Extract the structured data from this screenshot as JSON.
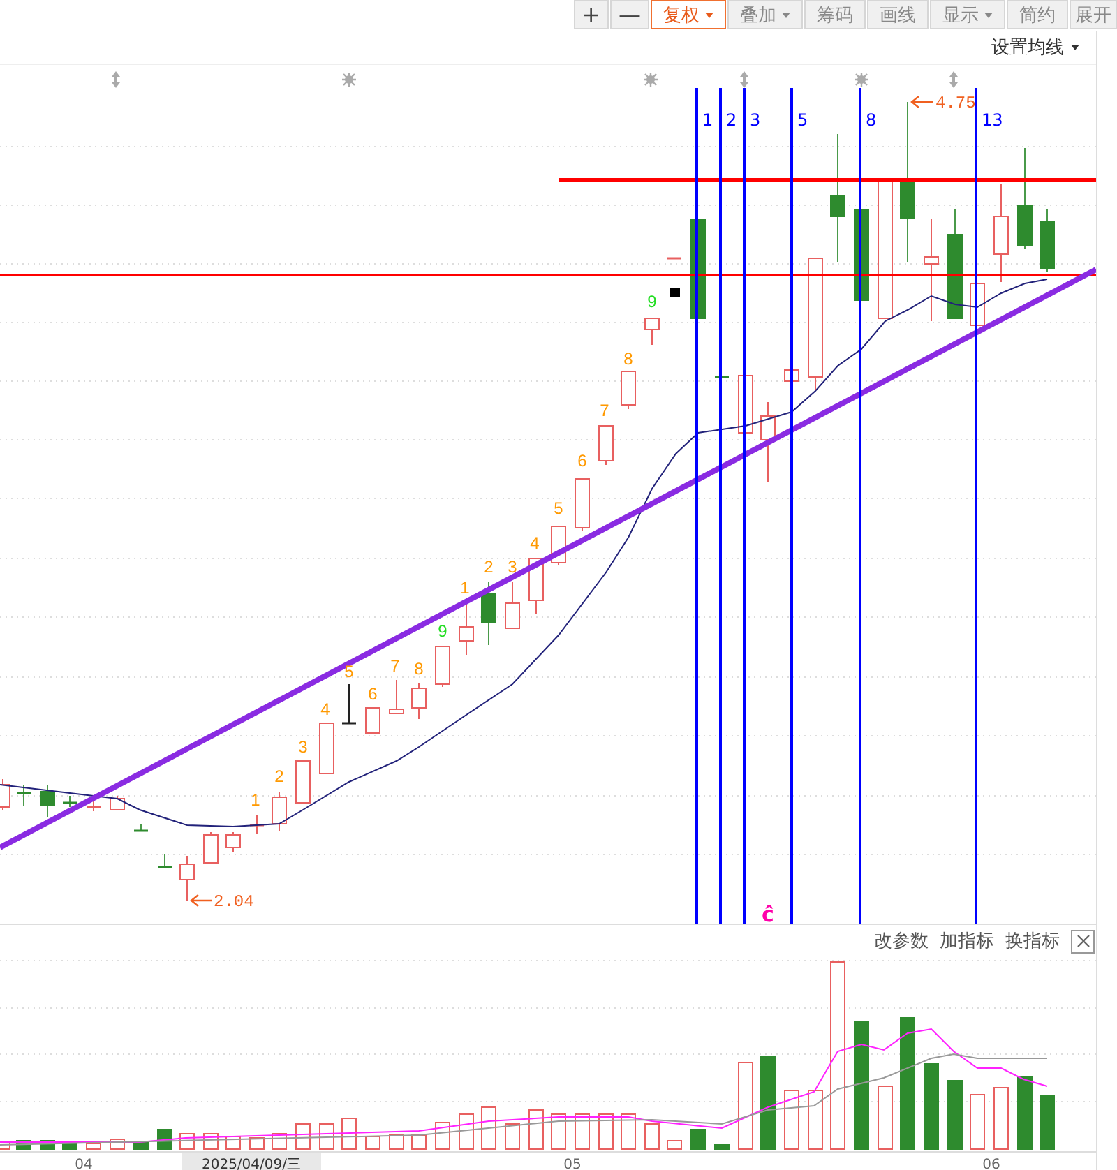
{
  "toolbar": [
    {
      "label": "+",
      "dropdown": false,
      "selected": false
    },
    {
      "label": "—",
      "dropdown": false,
      "selected": false
    },
    {
      "label": "复权",
      "dropdown": true,
      "selected": true
    },
    {
      "label": "叠加",
      "dropdown": true,
      "selected": false
    },
    {
      "label": "筹码",
      "dropdown": false,
      "selected": false
    },
    {
      "label": "画线",
      "dropdown": false,
      "selected": false
    },
    {
      "label": "显示",
      "dropdown": true,
      "selected": false
    },
    {
      "label": "简约",
      "dropdown": false,
      "selected": false
    },
    {
      "label": "展开",
      "dropdown": false,
      "selected": false
    }
  ],
  "chart": {
    "ma_setting": "设置均线",
    "count_labels": [
      {
        "text": "1",
        "color": "#ff9900"
      },
      {
        "text": "2",
        "color": "#ff9900"
      },
      {
        "text": "3",
        "color": "#ff9900"
      },
      {
        "text": "4",
        "color": "#ff9900"
      },
      {
        "text": "5",
        "color": "#ff9900"
      },
      {
        "text": "6",
        "color": "#ff9900"
      },
      {
        "text": "7",
        "color": "#ff9900"
      },
      {
        "text": "8",
        "color": "#ff9900"
      },
      {
        "text": "9",
        "color": "#22dd22"
      },
      {
        "text": "1",
        "color": "#ff9900"
      },
      {
        "text": "2",
        "color": "#ff9900"
      },
      {
        "text": "3",
        "color": "#ff9900"
      },
      {
        "text": "4",
        "color": "#ff9900"
      },
      {
        "text": "5",
        "color": "#ff9900"
      },
      {
        "text": "6",
        "color": "#ff9900"
      },
      {
        "text": "7",
        "color": "#ff9900"
      },
      {
        "text": "8",
        "color": "#ff9900"
      },
      {
        "text": "9",
        "color": "#22dd22"
      }
    ],
    "period_lines": [
      "1",
      "2",
      "3",
      "5",
      "8",
      "13"
    ],
    "high_mark": "4.75",
    "low_mark": "2.04",
    "signal_mark": "ĉ"
  },
  "indicator_panel": {
    "buttons": [
      "改参数",
      "加指标",
      "换指标"
    ]
  },
  "date_axis": [
    {
      "label": "04",
      "selected": false
    },
    {
      "label": "2025/04/09/三",
      "selected": true
    },
    {
      "label": "05",
      "selected": false
    },
    {
      "label": "06",
      "selected": false
    }
  ]
}
